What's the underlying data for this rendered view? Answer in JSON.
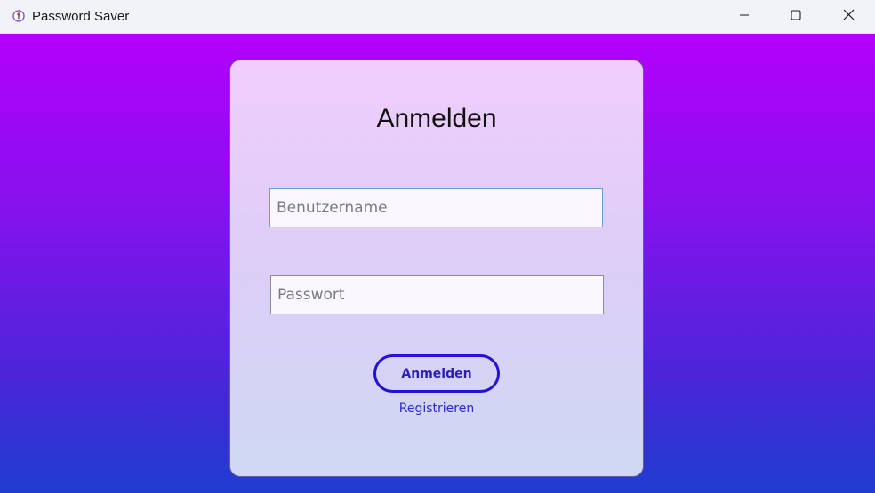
{
  "window": {
    "title": "Password Saver",
    "controls": {
      "minimize": "minimize-icon",
      "maximize": "maximize-icon",
      "close": "close-icon"
    }
  },
  "login": {
    "title": "Anmelden",
    "username_placeholder": "Benutzername",
    "username_value": "",
    "password_placeholder": "Passwort",
    "password_value": "",
    "submit_label": "Anmelden",
    "register_label": "Registrieren"
  },
  "colors": {
    "background_top": "#b300fb",
    "background_bottom": "#1f3dd0",
    "button_border": "#2311d6",
    "link": "#2a2ad0"
  }
}
